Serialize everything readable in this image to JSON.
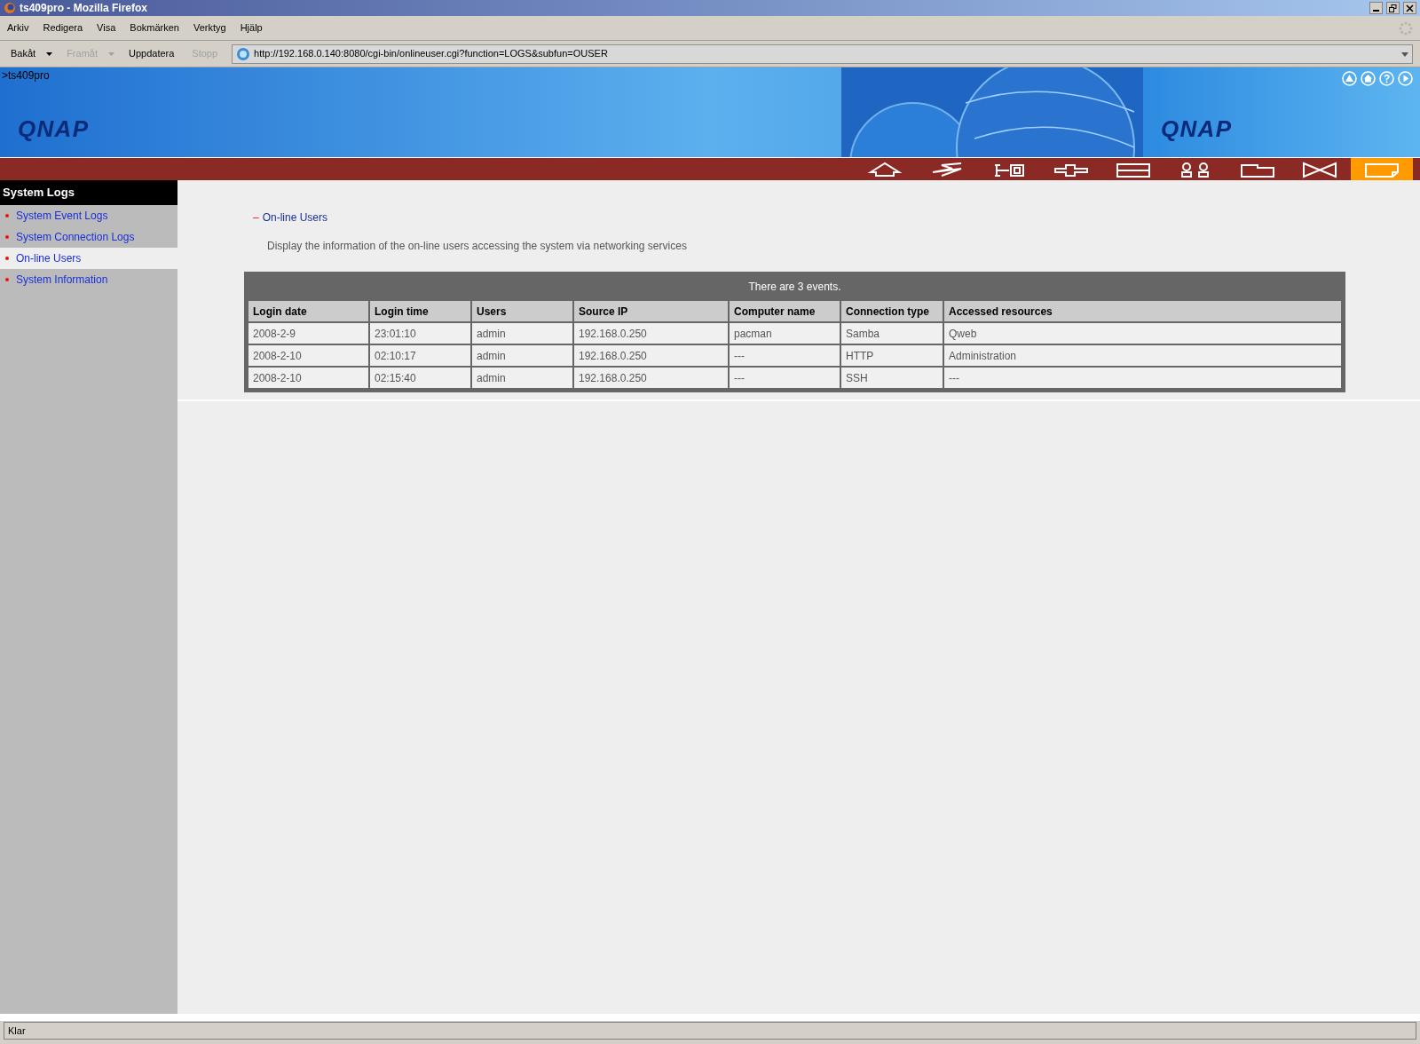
{
  "window": {
    "title": "ts409pro - Mozilla Firefox"
  },
  "menu": [
    "Arkiv",
    "Redigera",
    "Visa",
    "Bokmärken",
    "Verktyg",
    "Hjälp"
  ],
  "toolbar": [
    {
      "label": "Bakåt",
      "disabled": false,
      "dropdown": true
    },
    {
      "label": "Framåt",
      "disabled": true,
      "dropdown": true
    },
    {
      "label": "Uppdatera",
      "disabled": false,
      "dropdown": false
    },
    {
      "label": "Stopp",
      "disabled": true,
      "dropdown": false
    }
  ],
  "address": {
    "value": "http://192.168.0.140:8080/cgi-bin/onlineuser.cgi?function=LOGS&subfun=OUSER"
  },
  "banner": {
    "breadcrumb": ">ts409pro",
    "logos": [
      "QNAP",
      "QNAP"
    ]
  },
  "nav_tabs": [
    {
      "kind": "home",
      "selected": false
    },
    {
      "kind": "bolt",
      "selected": false
    },
    {
      "kind": "key",
      "selected": false
    },
    {
      "kind": "cross",
      "selected": false
    },
    {
      "kind": "drive",
      "selected": false
    },
    {
      "kind": "users",
      "selected": false
    },
    {
      "kind": "folder",
      "selected": false
    },
    {
      "kind": "bowtie",
      "selected": false
    },
    {
      "kind": "note",
      "selected": true
    }
  ],
  "sidebar": {
    "title": "System Logs",
    "items": [
      {
        "label": "System Event Logs",
        "selected": false
      },
      {
        "label": "System Connection Logs",
        "selected": false
      },
      {
        "label": "On-line Users",
        "selected": true
      },
      {
        "label": "System Information",
        "selected": false
      }
    ]
  },
  "section": {
    "marker": "–",
    "title": "On-line Users",
    "description": "Display the information of the on-line users accessing the system via networking services"
  },
  "table": {
    "caption": "There are 3 events.",
    "columns": [
      "Login date",
      "Login time",
      "Users",
      "Source IP",
      "Computer name",
      "Connection type",
      "Accessed resources"
    ],
    "rows": [
      [
        "2008-2-9",
        "23:01:10",
        "admin",
        "192.168.0.250",
        "pacman",
        "Samba",
        "Qweb"
      ],
      [
        "2008-2-10",
        "02:10:17",
        "admin",
        "192.168.0.250",
        "---",
        "HTTP",
        "Administration"
      ],
      [
        "2008-2-10",
        "02:15:40",
        "admin",
        "192.168.0.250",
        "---",
        "SSH",
        "---"
      ]
    ]
  },
  "status_bar": {
    "text": "Klar"
  }
}
